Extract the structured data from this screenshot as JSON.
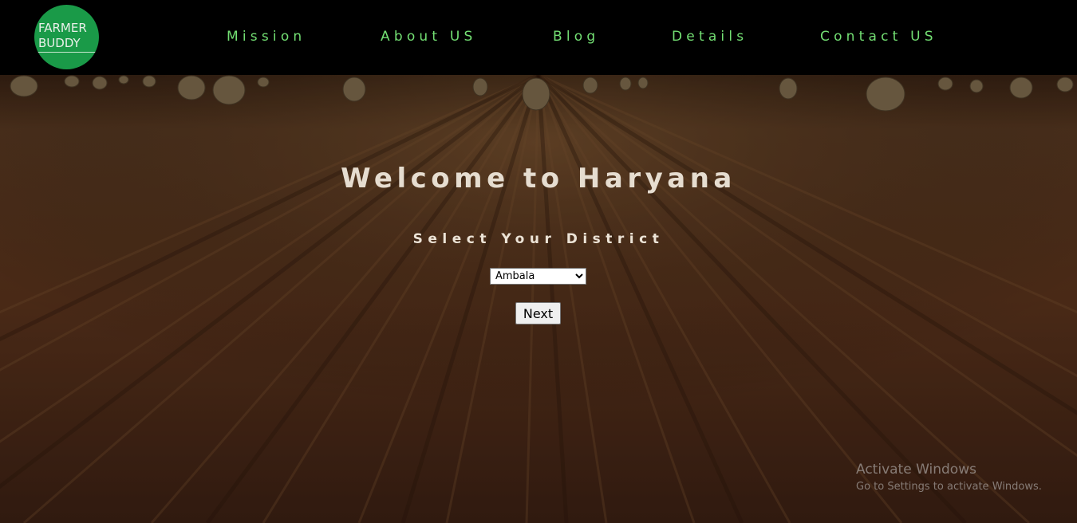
{
  "logo": {
    "line1": "FARMER",
    "line2": "BUDDY",
    "color": "#1a9a48"
  },
  "nav": {
    "items": [
      {
        "label": "Mission"
      },
      {
        "label": "About US"
      },
      {
        "label": "Blog"
      },
      {
        "label": "Details"
      },
      {
        "label": "Contact US"
      }
    ],
    "link_color": "#73df73"
  },
  "hero": {
    "title": "Welcome to Haryana",
    "subtitle": "Select Your District",
    "district_select": {
      "selected": "Ambala"
    },
    "next_label": "Next"
  },
  "watermark": {
    "title": "Activate Windows",
    "subtitle": "Go to Settings to activate Windows."
  }
}
